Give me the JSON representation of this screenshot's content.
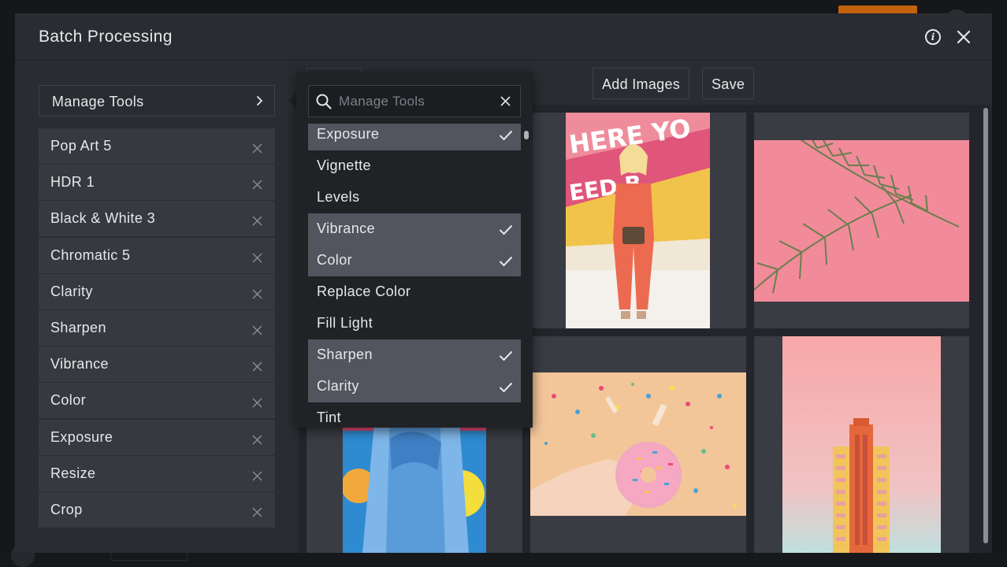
{
  "modal": {
    "title": "Batch Processing",
    "info_icon": "info-icon",
    "close_icon": "close-icon"
  },
  "left_panel": {
    "manage_tools_label": "Manage Tools",
    "tools": [
      {
        "label": "Pop Art 5"
      },
      {
        "label": "HDR 1"
      },
      {
        "label": "Black & White 3"
      },
      {
        "label": "Chromatic 5"
      },
      {
        "label": "Clarity"
      },
      {
        "label": "Sharpen"
      },
      {
        "label": "Vibrance"
      },
      {
        "label": "Color"
      },
      {
        "label": "Exposure"
      },
      {
        "label": "Resize"
      },
      {
        "label": "Crop"
      }
    ]
  },
  "toolbar": {
    "add_images_label": "Add Images",
    "save_label": "Save"
  },
  "dropdown": {
    "search_placeholder": "Manage Tools",
    "search_value": "",
    "items": [
      {
        "label": "Exposure",
        "checked": true
      },
      {
        "label": "Vignette",
        "checked": false
      },
      {
        "label": "Levels",
        "checked": false
      },
      {
        "label": "Vibrance",
        "checked": true
      },
      {
        "label": "Color",
        "checked": true
      },
      {
        "label": "Replace Color",
        "checked": false
      },
      {
        "label": "Fill Light",
        "checked": false
      },
      {
        "label": "Sharpen",
        "checked": true
      },
      {
        "label": "Clarity",
        "checked": true
      },
      {
        "label": "Tint",
        "checked": false
      }
    ]
  },
  "colors": {
    "modal_bg": "#2a2c31",
    "item_bg": "#37393f",
    "selected_bg": "#52555e",
    "text": "#e6e8eb",
    "accent": "#c2620b"
  }
}
